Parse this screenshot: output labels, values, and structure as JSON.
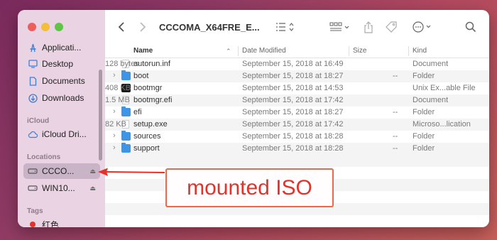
{
  "window": {
    "title": "CCCOMA_X64FRE_E..."
  },
  "sidebar": {
    "items_top": [
      {
        "label": "Applicati...",
        "icon": "applications-icon"
      },
      {
        "label": "Desktop",
        "icon": "desktop-icon"
      },
      {
        "label": "Documents",
        "icon": "documents-icon"
      },
      {
        "label": "Downloads",
        "icon": "downloads-icon"
      }
    ],
    "icloud_header": "iCloud",
    "icloud_drive": "iCloud Dri...",
    "locations_header": "Locations",
    "locations": [
      {
        "label": "CCCO...",
        "selected": true
      },
      {
        "label": "WIN10...",
        "selected": false
      }
    ],
    "tags_header": "Tags",
    "tags": [
      {
        "label": "红色",
        "color": "#e4322b"
      }
    ]
  },
  "columns": {
    "name": "Name",
    "date": "Date Modified",
    "size": "Size",
    "kind": "Kind"
  },
  "files": [
    {
      "name": "autorun.inf",
      "date": "September 15, 2018 at 16:49",
      "size": "128 bytes",
      "kind": "Document",
      "type": "doc",
      "folder": false
    },
    {
      "name": "boot",
      "date": "September 15, 2018 at 18:27",
      "size": "--",
      "kind": "Folder",
      "type": "folder",
      "folder": true
    },
    {
      "name": "bootmgr",
      "date": "September 15, 2018 at 14:53",
      "size": "408 KB",
      "kind": "Unix Ex...able File",
      "type": "exe",
      "folder": false
    },
    {
      "name": "bootmgr.efi",
      "date": "September 15, 2018 at 17:42",
      "size": "1.5 MB",
      "kind": "Document",
      "type": "doc",
      "folder": false
    },
    {
      "name": "efi",
      "date": "September 15, 2018 at 18:27",
      "size": "--",
      "kind": "Folder",
      "type": "folder",
      "folder": true
    },
    {
      "name": "setup.exe",
      "date": "September 15, 2018 at 17:42",
      "size": "82 KB",
      "kind": "Microso...lication",
      "type": "doc",
      "folder": false
    },
    {
      "name": "sources",
      "date": "September 15, 2018 at 18:28",
      "size": "--",
      "kind": "Folder",
      "type": "folder",
      "folder": true
    },
    {
      "name": "support",
      "date": "September 15, 2018 at 18:28",
      "size": "--",
      "kind": "Folder",
      "type": "folder",
      "folder": true
    }
  ],
  "annotation": {
    "text": "mounted ISO",
    "color": "#e4322b"
  },
  "colors": {
    "accent": "#3d95e8",
    "sidebar_bg": "#ead3e3"
  }
}
